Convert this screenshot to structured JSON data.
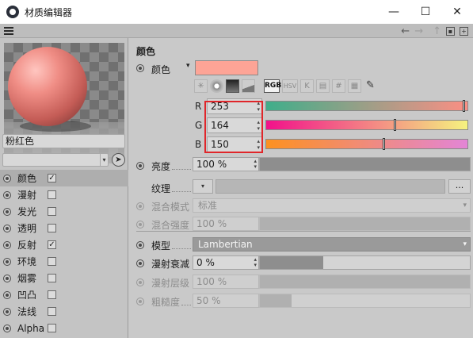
{
  "window": {
    "title": "材质编辑器",
    "minimize": "—",
    "maximize": "☐",
    "close": "✕"
  },
  "toolbar": {
    "back": "←",
    "forward": "→",
    "up": "↑",
    "lock": "🔒",
    "new": "+"
  },
  "preview": {
    "material_color": "#f08e86"
  },
  "material": {
    "name": "粉红色"
  },
  "channels": [
    {
      "label": "颜色",
      "checked": true,
      "mark": "✓"
    },
    {
      "label": "漫射",
      "checked": false,
      "mark": ""
    },
    {
      "label": "发光",
      "checked": false,
      "mark": ""
    },
    {
      "label": "透明",
      "checked": false,
      "mark": ""
    },
    {
      "label": "反射",
      "checked": true,
      "mark": "✓"
    },
    {
      "label": "环境",
      "checked": false,
      "mark": ""
    },
    {
      "label": "烟雾",
      "checked": false,
      "mark": ""
    },
    {
      "label": "凹凸",
      "checked": false,
      "mark": ""
    },
    {
      "label": "法线",
      "checked": false,
      "mark": ""
    },
    {
      "label": "Alpha",
      "checked": false,
      "mark": ""
    }
  ],
  "color_section": {
    "title": "颜色",
    "color_label": "颜色",
    "swatch_hex": "#fda496",
    "mode_rgb": "RGB",
    "mode_hsv": "HSV",
    "mode_k": "K",
    "mode_hash": "#",
    "rgb": [
      {
        "channel": "R",
        "value": "253",
        "fraction": 0.992
      },
      {
        "channel": "G",
        "value": "164",
        "fraction": 0.643
      },
      {
        "channel": "B",
        "value": "150",
        "fraction": 0.588
      }
    ],
    "brightness_label": "亮度",
    "brightness_value": "100 %",
    "texture_label": "纹理",
    "texture_more": "...",
    "mix_mode_label": "混合模式",
    "mix_mode_value": "标准",
    "mix_strength_label": "混合强度",
    "mix_strength_value": "100 %"
  },
  "shading": {
    "model_label": "模型",
    "model_value": "Lambertian",
    "diffuse_falloff_label": "漫射衰减",
    "diffuse_falloff_value": "0 %",
    "diffuse_falloff_fraction": 0.3,
    "diffuse_level_label": "漫射层级",
    "diffuse_level_value": "100 %",
    "roughness_label": "粗糙度",
    "roughness_value": "50 %",
    "roughness_fraction": 0.15
  }
}
